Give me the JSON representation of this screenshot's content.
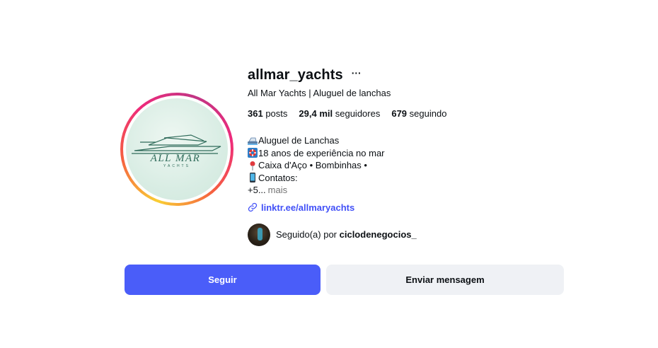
{
  "profile": {
    "username": "allmar_yachts",
    "more_label": "···",
    "full_name": "All Mar Yachts | Aluguel de lanchas",
    "avatar_logo_text": "ALL MAR",
    "avatar_logo_sub": "YACHTS",
    "stats": {
      "posts_count": "361",
      "posts_label": "posts",
      "followers_count": "29,4 mil",
      "followers_label": "seguidores",
      "following_count": "679",
      "following_label": "seguindo"
    },
    "bio": {
      "line1": "Aluguel de Lanchas",
      "line2": "18 anos de experiência no mar",
      "line3": "Caixa d'Aço • Bombinhas •",
      "line4": "Contatos:",
      "line5": "+5...",
      "more_label": "mais"
    },
    "link": "linktr.ee/allmaryachts",
    "followed_by_prefix": "Seguido(a) por",
    "followed_by_user": "ciclodenegocios_"
  },
  "actions": {
    "follow_label": "Seguir",
    "message_label": "Enviar mensagem"
  },
  "colors": {
    "accent": "#4a5df9",
    "link": "#4150f7",
    "secondary_button": "#eff1f5"
  }
}
